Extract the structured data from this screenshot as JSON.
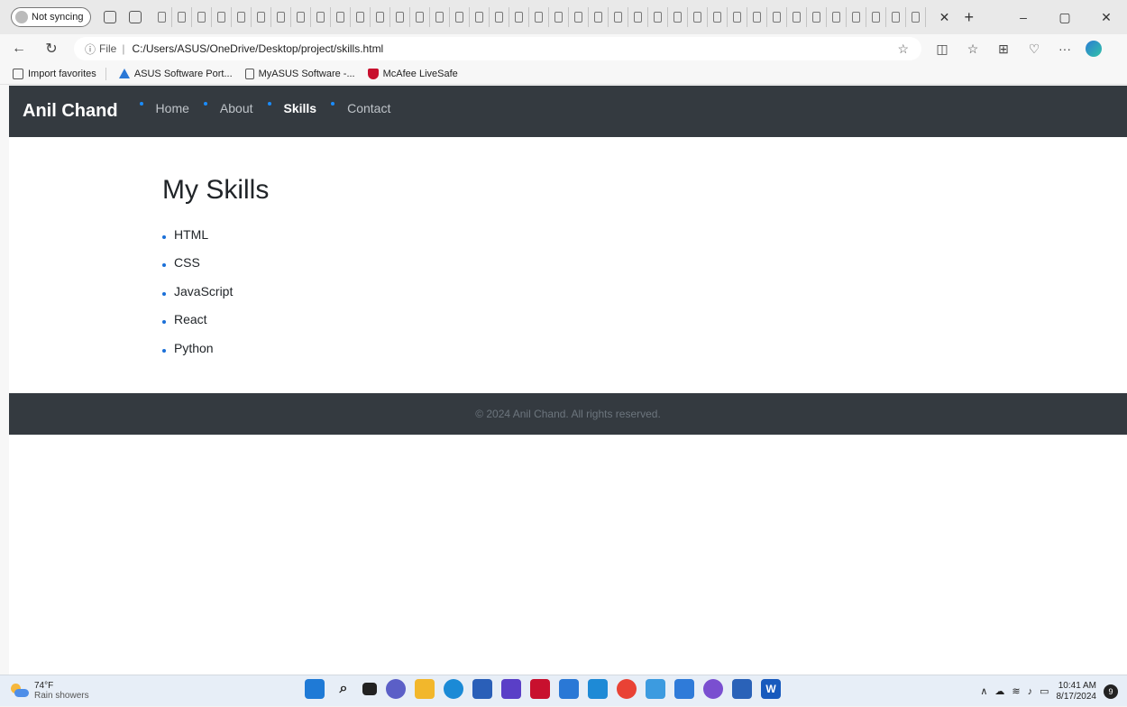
{
  "browser": {
    "profile_label": "Not syncing",
    "url_scheme": "File",
    "url_path": "C:/Users/ASUS/OneDrive/Desktop/project/skills.html",
    "favorites": [
      {
        "label": "Import favorites"
      },
      {
        "label": "ASUS Software Port..."
      },
      {
        "label": "MyASUS Software -..."
      },
      {
        "label": "McAfee LiveSafe"
      }
    ]
  },
  "site": {
    "brand": "Anil Chand",
    "nav": [
      {
        "label": "Home"
      },
      {
        "label": "About"
      },
      {
        "label": "Skills"
      },
      {
        "label": "Contact"
      }
    ],
    "page_title": "My Skills",
    "skills": [
      "HTML",
      "CSS",
      "JavaScript",
      "React",
      "Python"
    ],
    "footer": "© 2024 Anil Chand. All rights reserved.",
    "colors": {
      "header_bg": "#343a40",
      "bullet": "#1a8cff",
      "active_nav": "#ffffff"
    }
  },
  "taskbar": {
    "temperature": "74°F",
    "condition": "Rain showers",
    "time": "10:41 AM",
    "date": "8/17/2024",
    "notifications": "9"
  }
}
